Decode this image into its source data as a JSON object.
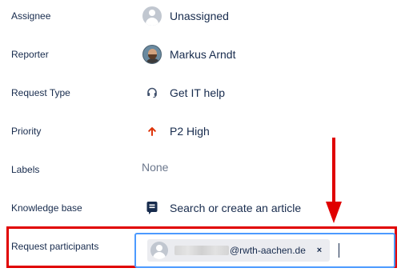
{
  "fields": {
    "assignee": {
      "label": "Assignee",
      "value": "Unassigned"
    },
    "reporter": {
      "label": "Reporter",
      "value": "Markus Arndt"
    },
    "request_type": {
      "label": "Request Type",
      "value": "Get IT help"
    },
    "priority": {
      "label": "Priority",
      "value": "P2 High"
    },
    "labels": {
      "label": "Labels",
      "value": "None"
    },
    "knowledge_base": {
      "label": "Knowledge base",
      "value": "Search or create an article"
    },
    "request_participants": {
      "label": "Request participants",
      "chips": [
        {
          "email_domain": "@rwth-aachen.de",
          "remove_symbol": "×"
        }
      ]
    }
  },
  "colors": {
    "highlight": "#e00000",
    "input_focus": "#4c9aff",
    "priority_high": "#de350b",
    "text": "#172b4d",
    "muted": "#6b778c"
  },
  "icons": {
    "assignee": "user-avatar-icon",
    "reporter": "user-photo-avatar",
    "request_type": "headset-icon",
    "priority": "arrow-up-icon",
    "knowledge_base": "article-icon",
    "annotation": "red-down-arrow"
  }
}
